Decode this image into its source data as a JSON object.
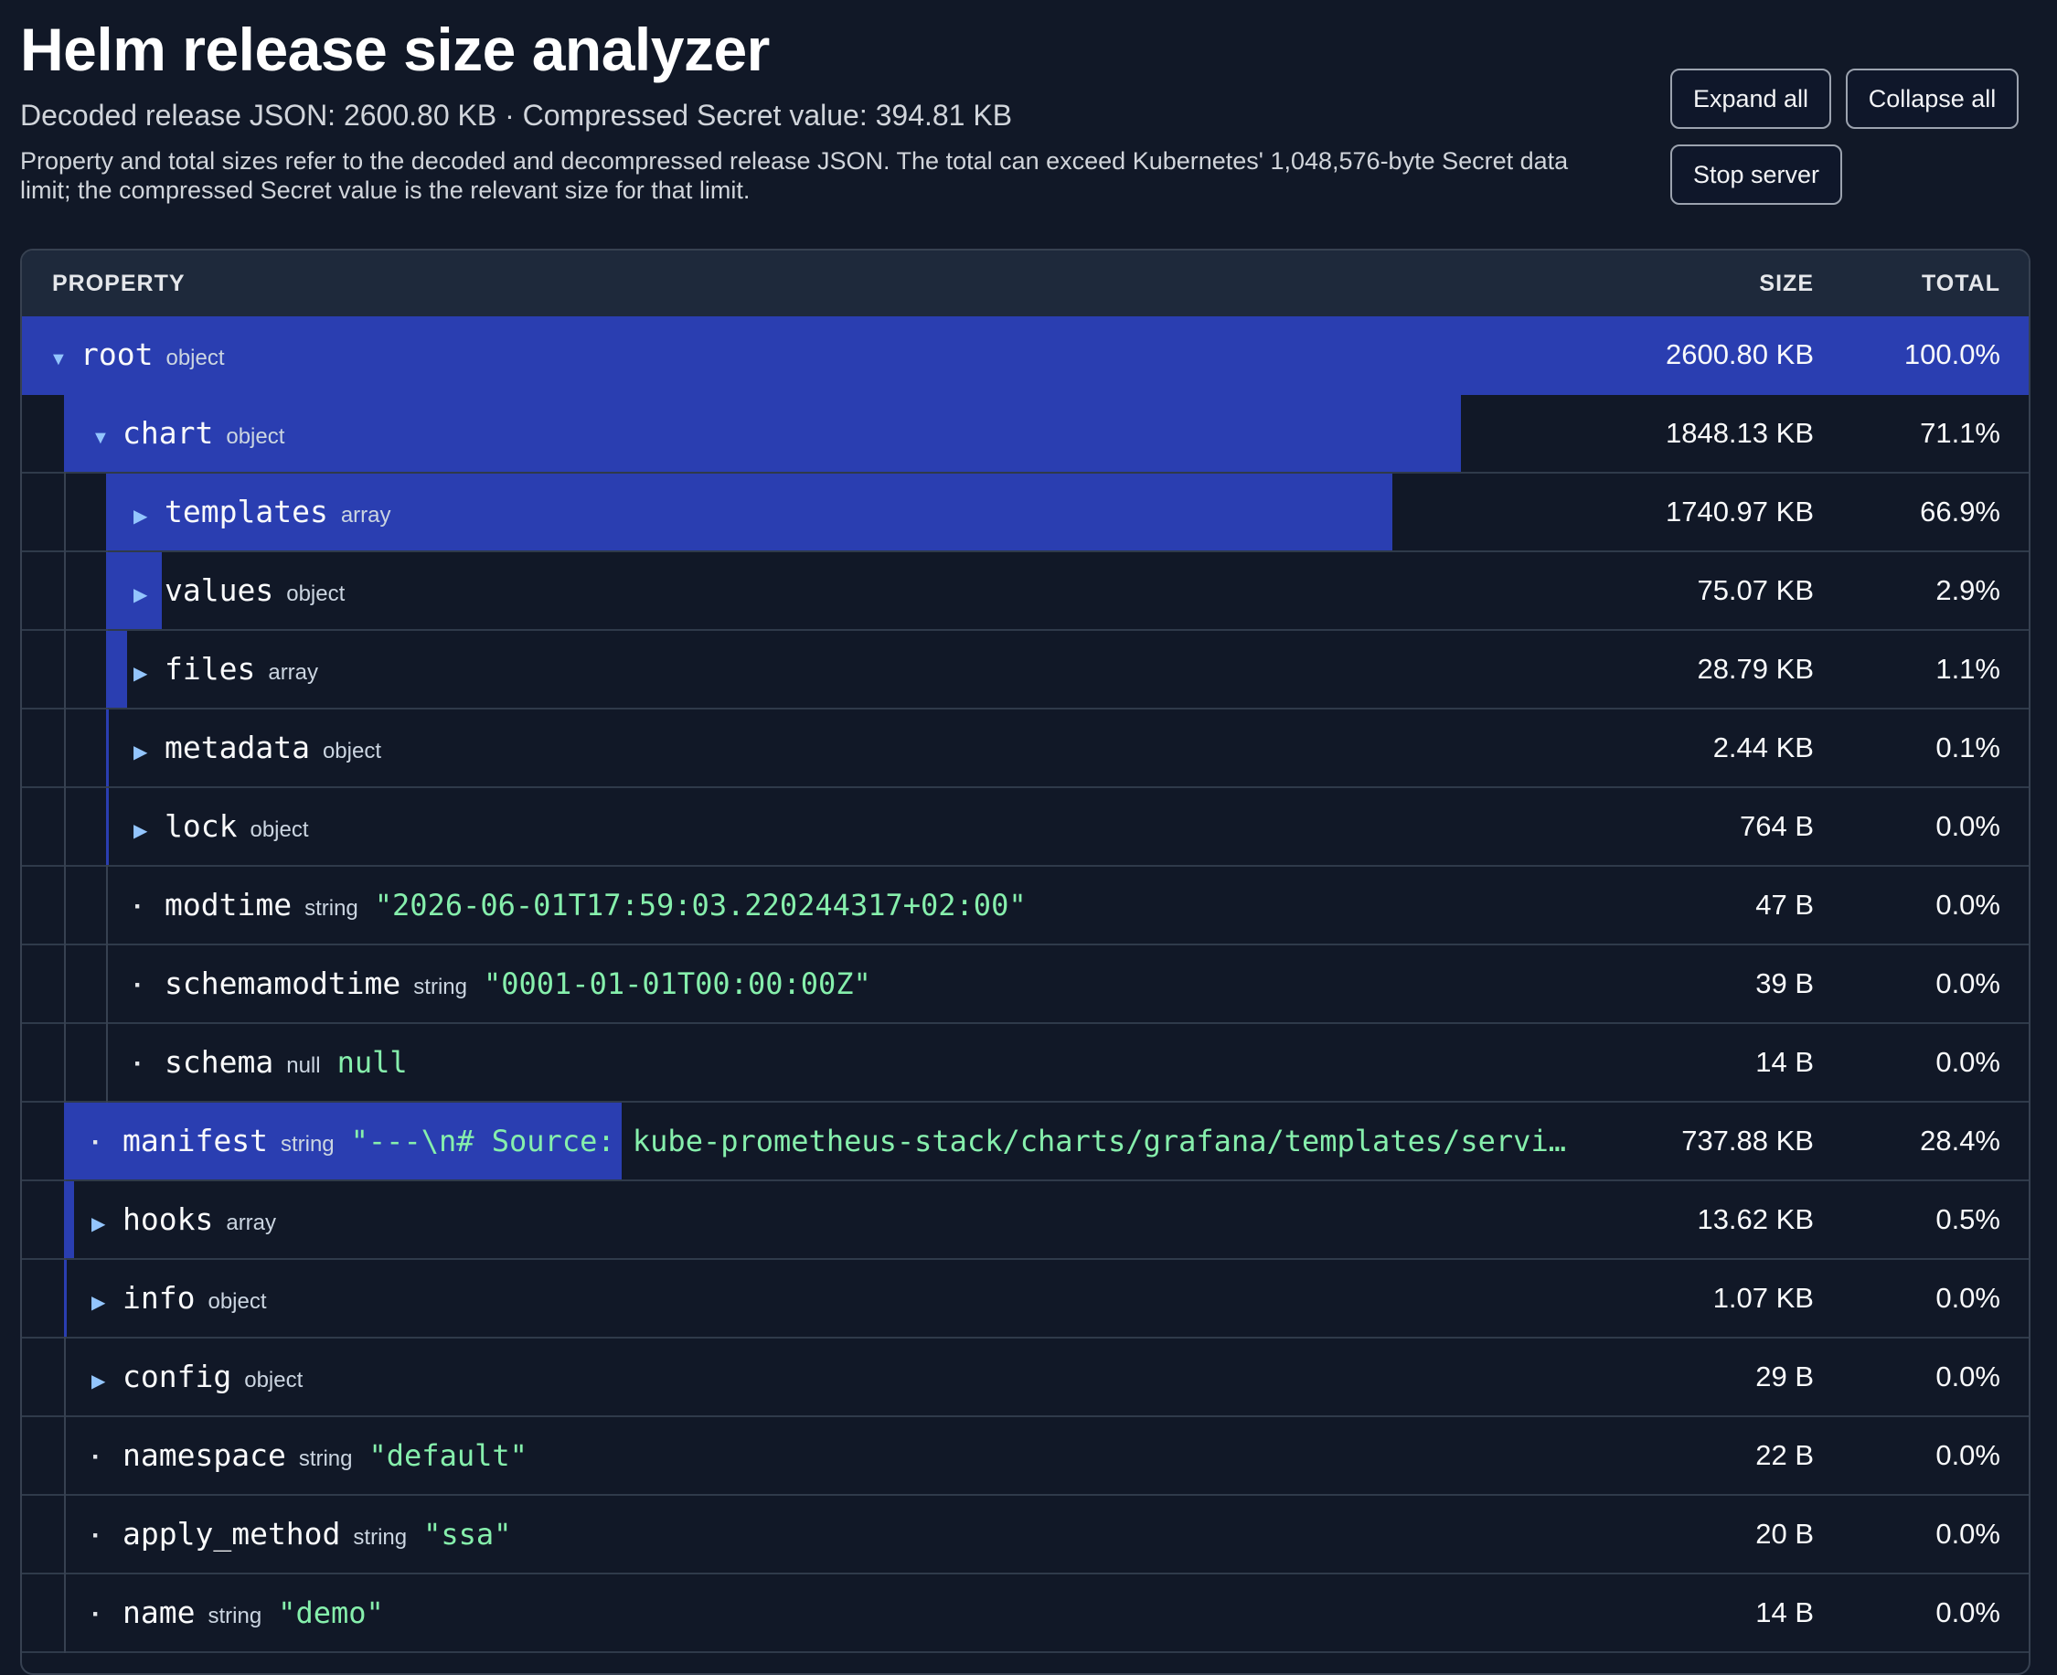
{
  "header": {
    "title": "Helm release size analyzer",
    "summary": "Decoded release JSON: 2600.80 KB · Compressed Secret value: 394.81 KB",
    "note": "Property and total sizes refer to the decoded and decompressed release JSON. The total can exceed Kubernetes' 1,048,576-byte Secret data limit; the compressed Secret value is the relevant size for that limit."
  },
  "actions": {
    "expand_all": "Expand all",
    "collapse_all": "Collapse all",
    "stop_server": "Stop server"
  },
  "table": {
    "columns": {
      "property": "PROPERTY",
      "size": "SIZE",
      "total": "TOTAL"
    },
    "rows": [
      {
        "key": "root",
        "type": "object",
        "value": "",
        "size": "2600.80 KB",
        "total": "100.0%",
        "depth": 0,
        "expandable": true,
        "expanded": true,
        "share": 1.0
      },
      {
        "key": "chart",
        "type": "object",
        "value": "",
        "size": "1848.13 KB",
        "total": "71.1%",
        "depth": 1,
        "expandable": true,
        "expanded": true,
        "share": 0.711
      },
      {
        "key": "templates",
        "type": "array",
        "value": "",
        "size": "1740.97 KB",
        "total": "66.9%",
        "depth": 2,
        "expandable": true,
        "expanded": false,
        "share": 0.669
      },
      {
        "key": "values",
        "type": "object",
        "value": "",
        "size": "75.07 KB",
        "total": "2.9%",
        "depth": 2,
        "expandable": true,
        "expanded": false,
        "share": 0.029
      },
      {
        "key": "files",
        "type": "array",
        "value": "",
        "size": "28.79 KB",
        "total": "1.1%",
        "depth": 2,
        "expandable": true,
        "expanded": false,
        "share": 0.011
      },
      {
        "key": "metadata",
        "type": "object",
        "value": "",
        "size": "2.44 KB",
        "total": "0.1%",
        "depth": 2,
        "expandable": true,
        "expanded": false,
        "share": 0.001
      },
      {
        "key": "lock",
        "type": "object",
        "value": "",
        "size": "764 B",
        "total": "0.0%",
        "depth": 2,
        "expandable": true,
        "expanded": false,
        "share": 0.0003
      },
      {
        "key": "modtime",
        "type": "string",
        "value": "\"2026-06-01T17:59:03.220244317+02:00\"",
        "size": "47 B",
        "total": "0.0%",
        "depth": 2,
        "expandable": false,
        "share": 0.0
      },
      {
        "key": "schemamodtime",
        "type": "string",
        "value": "\"0001-01-01T00:00:00Z\"",
        "size": "39 B",
        "total": "0.0%",
        "depth": 2,
        "expandable": false,
        "share": 0.0
      },
      {
        "key": "schema",
        "type": "null",
        "value": "null",
        "size": "14 B",
        "total": "0.0%",
        "depth": 2,
        "expandable": false,
        "share": 0.0
      },
      {
        "key": "manifest",
        "type": "string",
        "value": "\"---\\n# Source: kube-prometheus-stack/charts/grafana/templates/servi…",
        "size": "737.88 KB",
        "total": "28.4%",
        "depth": 1,
        "expandable": false,
        "share": 0.284
      },
      {
        "key": "hooks",
        "type": "array",
        "value": "",
        "size": "13.62 KB",
        "total": "0.5%",
        "depth": 1,
        "expandable": true,
        "expanded": false,
        "share": 0.005
      },
      {
        "key": "info",
        "type": "object",
        "value": "",
        "size": "1.07 KB",
        "total": "0.0%",
        "depth": 1,
        "expandable": true,
        "expanded": false,
        "share": 0.0004
      },
      {
        "key": "config",
        "type": "object",
        "value": "",
        "size": "29 B",
        "total": "0.0%",
        "depth": 1,
        "expandable": true,
        "expanded": false,
        "share": 0.0
      },
      {
        "key": "namespace",
        "type": "string",
        "value": "\"default\"",
        "size": "22 B",
        "total": "0.0%",
        "depth": 1,
        "expandable": false,
        "share": 0.0
      },
      {
        "key": "apply_method",
        "type": "string",
        "value": "\"ssa\"",
        "size": "20 B",
        "total": "0.0%",
        "depth": 1,
        "expandable": false,
        "share": 0.0
      },
      {
        "key": "name",
        "type": "string",
        "value": "\"demo\"",
        "size": "14 B",
        "total": "0.0%",
        "depth": 1,
        "expandable": false,
        "share": 0.0
      }
    ]
  },
  "colors": {
    "background": "#111827",
    "header_row": "#1e293b",
    "size_bar": "#2a3eb1",
    "string_value": "#86efac",
    "toggle": "#93c5fd"
  }
}
